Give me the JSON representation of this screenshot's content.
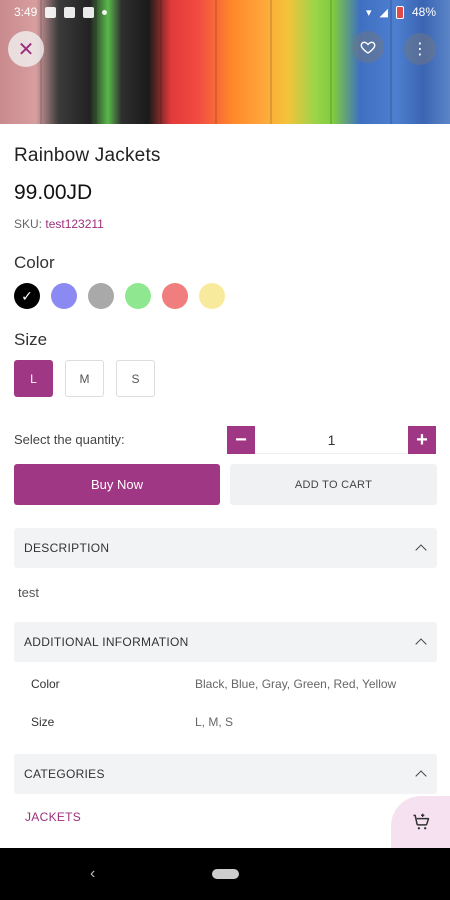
{
  "status": {
    "time": "3:49",
    "battery": "48%"
  },
  "product": {
    "title": "Rainbow Jackets",
    "price": "99.00JD",
    "sku_label": "SKU:",
    "sku_value": "test123211"
  },
  "color": {
    "label": "Color",
    "options": [
      {
        "name": "Black",
        "hex": "#000000",
        "selected": true
      },
      {
        "name": "Blue",
        "hex": "#8a8af2"
      },
      {
        "name": "Gray",
        "hex": "#a9a9a9"
      },
      {
        "name": "Green",
        "hex": "#8fe88f"
      },
      {
        "name": "Red",
        "hex": "#f07e7e"
      },
      {
        "name": "Yellow",
        "hex": "#f8ea9c"
      }
    ]
  },
  "size": {
    "label": "Size",
    "options": [
      "L",
      "M",
      "S"
    ],
    "selected": "L"
  },
  "quantity": {
    "label": "Select the quantity:",
    "value": "1",
    "minus": "−",
    "plus": "+"
  },
  "buttons": {
    "buy_now": "Buy Now",
    "add_to_cart": "ADD TO CART"
  },
  "sections": {
    "description": {
      "title": "DESCRIPTION",
      "text": "test"
    },
    "additional": {
      "title": "ADDITIONAL INFORMATION",
      "rows": [
        {
          "key": "Color",
          "value": "Black, Blue, Gray, Green, Red, Yellow"
        },
        {
          "key": "Size",
          "value": "L, M, S"
        }
      ]
    },
    "categories": {
      "title": "CATEGORIES",
      "items": [
        "JACKETS"
      ]
    }
  },
  "icons": {
    "close": "close-icon",
    "favorite": "heart-icon",
    "more": "more-vertical-icon",
    "cart": "cart-icon"
  },
  "colors": {
    "accent": "#a03784",
    "accent_light": "#f5e1ef",
    "panel": "#f2f3f5"
  }
}
